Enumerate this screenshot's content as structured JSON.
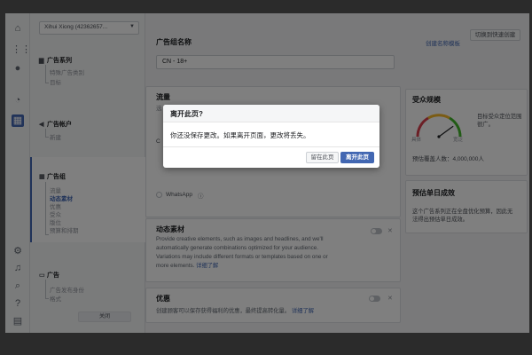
{
  "colors": {
    "accent": "#4267b2",
    "background": "#f2f3f5",
    "danger": "#d93f4c",
    "ok": "#42b72a"
  },
  "sidebar": {
    "account_label": "Xihui Xiong (42362657...",
    "sections": [
      {
        "title": "广告系列",
        "icon": "folder-icon",
        "items": [
          "特殊广告类别",
          "目标"
        ]
      },
      {
        "title": "广告帐户",
        "icon": "megaphone-icon",
        "items": [
          "新建"
        ]
      },
      {
        "title": "广告组",
        "icon": "grid-icon",
        "items": [
          "流量",
          "动态素材",
          "优惠",
          "受众",
          "版位",
          "预算和排期"
        ],
        "current": "动态素材"
      },
      {
        "title": "广告",
        "icon": "ad-icon",
        "items": [
          "广告发布身份",
          "格式"
        ]
      }
    ],
    "close_label": "关闭"
  },
  "main": {
    "switch_button": "切换到快速创建",
    "adset_name_label": "广告组名称",
    "create_template_link": "创建名称模板",
    "adset_name_value": "CN - 18+",
    "traffic_title": "流量",
    "traffic_sub": "选",
    "traffic_option_letter": "C",
    "whatsapp_label": "WhatsApp",
    "dynamic_title": "动态素材",
    "dynamic_desc_1": "Provide creative elements, such as images and headlines, and we'll",
    "dynamic_desc_2": "automatically generate combinations optimized for your audience.",
    "dynamic_desc_3": "Variations may include different formats or templates based on one or",
    "dynamic_desc_4": "more elements.",
    "learn_more": "详细了解",
    "offer_title": "优惠",
    "offer_desc": "创建顾客可以保存获得福利的优惠，最终提高转化量。",
    "offer_learn_more": "详细了解"
  },
  "audience": {
    "title": "受众规模",
    "desc_1": "目标受众定位范围",
    "desc_2": "很广。",
    "gauge_left": "具体",
    "gauge_right": "宽泛",
    "reach_label": "预估覆盖人数：",
    "reach_value": "4,000,000人",
    "gauge_level": 0.8
  },
  "results": {
    "title": "预估单日成效",
    "desc_1": "这个广告系列正在全盘优化预算，因此无",
    "desc_2": "法得出预估单日成效。"
  },
  "modal": {
    "title": "离开此页?",
    "body": "你还没保存更改。如果离开页面，更改将丢失。",
    "stay_label": "留在此页",
    "leave_label": "离开此页"
  }
}
